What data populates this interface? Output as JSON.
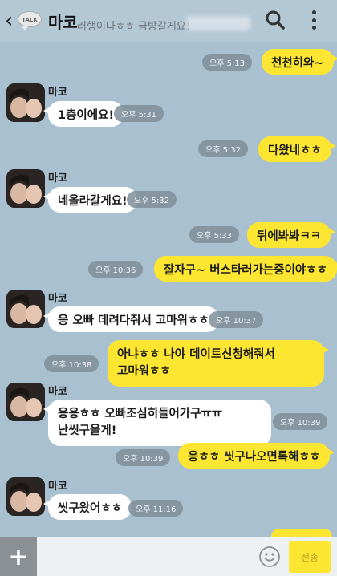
{
  "header": {
    "back_icon": "chevron-left-icon",
    "logo_text": "TALK",
    "title": "마코",
    "notice": "러행이다ㅎㅎ 금방갈게요!",
    "search_icon": "search-icon",
    "menu_icon": "more-vert-icon"
  },
  "contact_name": "마코",
  "messages": [
    {
      "from": "me",
      "text": "천천히와~",
      "time": "오후 5:13"
    },
    {
      "from": "you",
      "text": "1층이에요!",
      "time": "오후 5:31"
    },
    {
      "from": "me",
      "text": "다왔네ㅎㅎ",
      "time": "오후 5:32"
    },
    {
      "from": "you",
      "text": "네올라갈게요!",
      "time": "오후 5:32"
    },
    {
      "from": "me",
      "text": "뒤에봐봐ㅋㅋ",
      "time": "오후 5:33"
    },
    {
      "from": "me",
      "text": "잘자구~ 버스타러가는중이야ㅎㅎ",
      "time": "오후 10:36"
    },
    {
      "from": "you",
      "text": "응 오빠 데려다줘서 고마워ㅎㅎ",
      "time": "오후 10:37"
    },
    {
      "from": "me",
      "lines": [
        "아냐ㅎㅎ 나야 데이트신청해줘서",
        "고마워ㅎㅎ"
      ],
      "time": "오후 10:38"
    },
    {
      "from": "you",
      "lines": [
        "응응ㅎㅎ 오빠조심히들어가구ㅠㅠ",
        "난씻구올게!"
      ],
      "time": "오후 10:39"
    },
    {
      "from": "me",
      "text": "응ㅎㅎ 씻구나오면톡해ㅎㅎ",
      "time": "오후 10:39"
    },
    {
      "from": "you",
      "text": "씻구왔어ㅎㅎ",
      "time": "오후 11:16"
    }
  ],
  "input": {
    "plus_label": "+",
    "placeholder": "",
    "emoji_icon": "smiley-icon",
    "send_label": "전송"
  },
  "colors": {
    "background": "#a8c0cf",
    "my_bubble": "#fde631",
    "their_bubble": "#ffffff",
    "time_badge": "#7f8f99"
  }
}
